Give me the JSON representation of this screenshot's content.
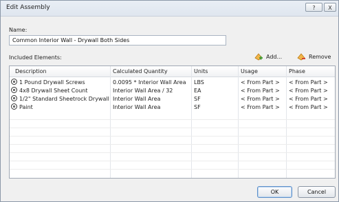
{
  "window": {
    "title": "Edit Assembly",
    "help_label": "?",
    "close_label": "X"
  },
  "name": {
    "label": "Name:",
    "value": "Common Interior Wall - Drywall Both Sides"
  },
  "elements": {
    "label": "Included Elements:",
    "add_label": "Add...",
    "remove_label": "Remove",
    "columns": [
      "Description",
      "Calculated Quantity",
      "Units",
      "Usage",
      "Phase"
    ],
    "rows": [
      {
        "description": "1 Pound Drywall Screws",
        "quantity": "0.0095 * Interior Wall Area",
        "units": "LBS",
        "usage": "< From Part >",
        "phase": "< From Part >"
      },
      {
        "description": "4x8 Drywall Sheet Count",
        "quantity": "Interior Wall Area / 32",
        "units": "EA",
        "usage": "< From Part >",
        "phase": "< From Part >"
      },
      {
        "description": "1/2\" Standard Sheetrock Drywall",
        "quantity": "Interior Wall Area",
        "units": "SF",
        "usage": "< From Part >",
        "phase": "< From Part >"
      },
      {
        "description": "Paint",
        "quantity": "Interior Wall Area",
        "units": "SF",
        "usage": "< From Part >",
        "phase": "< From Part >"
      }
    ]
  },
  "buttons": {
    "ok": "OK",
    "cancel": "Cancel"
  },
  "icons": {
    "add": "add-element-icon",
    "remove": "remove-element-icon",
    "row": "assembly-part-icon"
  }
}
